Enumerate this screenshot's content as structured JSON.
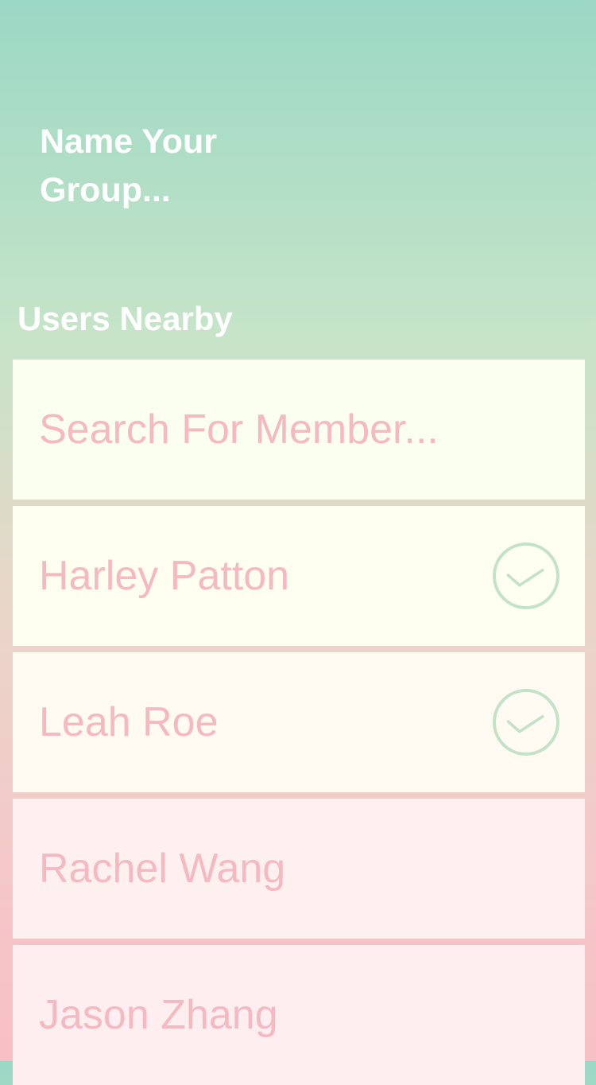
{
  "header": {
    "group_name_placeholder": "Name Your\nGroup..."
  },
  "users_section": {
    "title": "Users Nearby",
    "search_placeholder": "Search For Member...",
    "members": [
      {
        "name": "Harley Patton",
        "selected": true,
        "icon": "check-circle-icon"
      },
      {
        "name": "Leah Roe",
        "selected": true,
        "icon": "check-circle-icon"
      },
      {
        "name": "Rachel Wang",
        "selected": false
      },
      {
        "name": "Jason Zhang",
        "selected": false
      }
    ]
  },
  "colors": {
    "text_pink": "#f5b9c1",
    "check_green": "#c3e3c8",
    "white": "#ffffff"
  }
}
